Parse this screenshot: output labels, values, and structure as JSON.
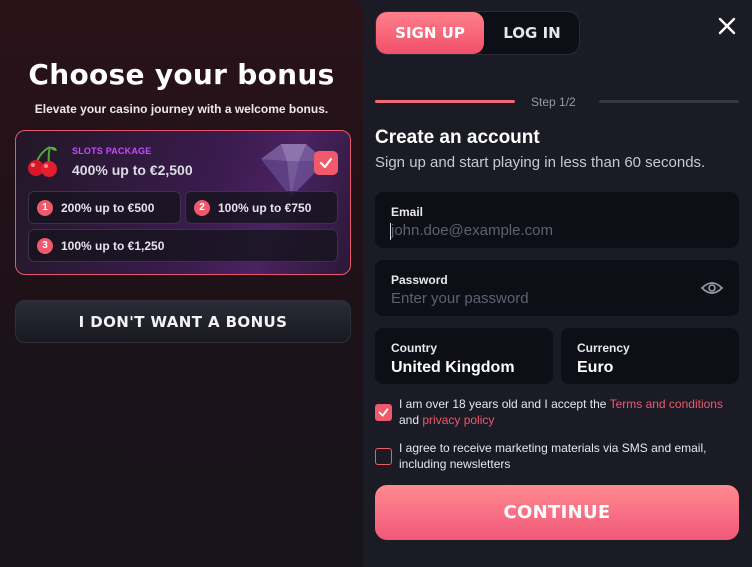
{
  "bonus_panel": {
    "title": "Choose your bonus",
    "subtitle": "Elevate your casino journey with a welcome bonus.",
    "package": {
      "tag": "SLOTS PACKAGE",
      "value": "400% up to €2,500",
      "selected": true,
      "icon": "cherry-icon",
      "options": [
        {
          "num": "1",
          "label": "200% up to €500"
        },
        {
          "num": "2",
          "label": "100% up to €750"
        },
        {
          "num": "3",
          "label": "100% up to €1,250"
        }
      ]
    },
    "no_bonus_label": "I DON'T WANT A BONUS"
  },
  "tabs": {
    "signup": "SIGN UP",
    "login": "LOG IN",
    "active": "signup"
  },
  "step": {
    "label": "Step 1/2",
    "current": 1,
    "total": 2
  },
  "form": {
    "title": "Create an account",
    "subtitle": "Sign up and start playing in less than 60 seconds.",
    "email": {
      "label": "Email",
      "placeholder": "john.doe@example.com",
      "value": ""
    },
    "password": {
      "label": "Password",
      "placeholder": "Enter your password",
      "value": ""
    },
    "country": {
      "label": "Country",
      "value": "United Kingdom"
    },
    "currency": {
      "label": "Currency",
      "value": "Euro"
    },
    "age_consent": {
      "checked": true,
      "text_before": "I am over 18 years old and I accept the ",
      "terms_link": "Terms and conditions",
      "text_and": "and ",
      "privacy_link": "privacy policy"
    },
    "marketing_consent": {
      "checked": false,
      "text": "I agree to receive marketing materials via SMS and email, including newsletters"
    },
    "continue_label": "CONTINUE"
  },
  "colors": {
    "accent": "#f0586c",
    "purple_tag": "#c44cff",
    "panel_bg": "#1a1b25",
    "input_bg": "#0d0e16"
  }
}
